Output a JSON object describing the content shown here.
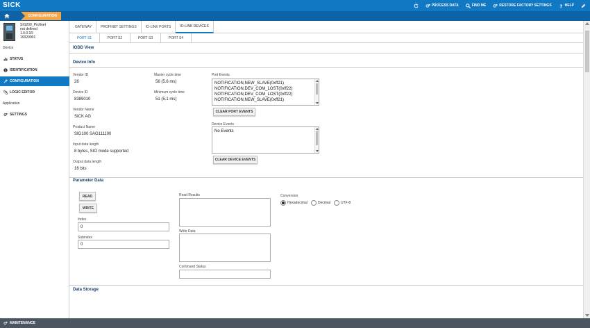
{
  "brand": {
    "logo": "SICK",
    "accent": "#1179c4",
    "crumb_color": "#f5a54a"
  },
  "topnav": {
    "process_data": "PROCESS DATA",
    "find_me": "FIND ME",
    "restore": "RESTORE FACTORY SETTINGS",
    "help": "HELP"
  },
  "breadcrumb": {
    "current": "CONFIGURATION"
  },
  "device": {
    "name": "SIG200_Profinet",
    "line2": "not defined",
    "version": "1.0.0.1R",
    "serial": "19320001"
  },
  "sidebar": {
    "section_device": "Device",
    "status": "STATUS",
    "identification": "IDENTIFICATION",
    "configuration": "CONFIGURATION",
    "logic_editor": "LOGIC EDITOR",
    "section_application": "Application",
    "settings": "SETTINGS"
  },
  "bottom": {
    "maintenance": "MAINTENANCE"
  },
  "tabs": [
    "GATEWAY",
    "PROFINET SETTINGS",
    "IO-LINK PORTS",
    "IO-LINK DEVICES"
  ],
  "ports": [
    "PORT S1",
    "PORT S2",
    "PORT S3",
    "PORT S4"
  ],
  "iodd_view": "IODD View",
  "device_info": {
    "title": "Device Info",
    "vendor_id_label": "Vendor ID",
    "vendor_id": "26",
    "device_id_label": "Device ID",
    "device_id": "8389010",
    "vendor_name_label": "Vendor Name",
    "vendor_name": "SICK AG",
    "product_name_label": "Product Name",
    "product_name": "SIG100 SAG111100",
    "input_len_label": "Input data length",
    "input_len": "8 bytes, SIO mode supported",
    "output_len_label": "Output data length",
    "output_len": "16 bits",
    "master_cycle_label": "Master cycle time",
    "master_cycle": "56 (5.6 ms)",
    "min_cycle_label": "Minimum cycle time",
    "min_cycle": "51 (5.1 ms)",
    "port_events_label": "Port Events",
    "port_events": [
      "NOTIFICATION,NEW_SLAVE(0xff21)",
      "NOTIFICATION,DEV_COM_LOST(0xff22)",
      "NOTIFICATION,DEV_COM_LOST(0xff22)",
      "NOTIFICATION,NEW_SLAVE(0xff21)"
    ],
    "clear_port_events": "CLEAR PORT EVENTS",
    "device_events_label": "Device Events",
    "device_events": "No Events",
    "clear_device_events": "CLEAR DEVICE EVENTS"
  },
  "parameter_data": {
    "title": "Parameter Data",
    "read": "READ",
    "write": "WRITE",
    "index_label": "Index",
    "index_value": "0",
    "subindex_label": "Subindex",
    "subindex_value": "0",
    "read_results_label": "Read Results",
    "write_data_label": "Write Data",
    "command_status_label": "Command Status",
    "conversion_label": "Conversion",
    "conversion_options": [
      "Hexadecimal",
      "Decimal",
      "UTF-8"
    ],
    "conversion_selected": "Hexadecimal"
  },
  "data_storage": {
    "title": "Data Storage"
  }
}
